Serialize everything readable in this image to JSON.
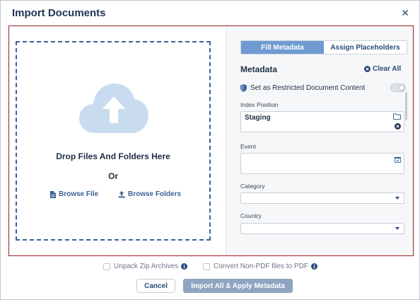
{
  "dialog": {
    "title": "Import Documents",
    "close_icon": "close-icon"
  },
  "dropzone": {
    "icon": "cloud-upload-icon",
    "drop_text": "Drop Files And Folders Here",
    "or_text": "Or",
    "browse_file_label": "Browse File",
    "browse_file_icon": "file-icon",
    "browse_folders_label": "Browse Folders",
    "browse_folders_icon": "upload-icon"
  },
  "tabs": [
    {
      "label": "Fill Metadata",
      "active": true
    },
    {
      "label": "Assign Placeholders",
      "active": false
    }
  ],
  "metadata": {
    "heading": "Metadata",
    "clear_all_label": "Clear All",
    "restricted_label": "Set as Restricted Document Content",
    "restricted_enabled": false,
    "index_position_label": "Index Position",
    "index_position_value": "Staging",
    "event_label": "Event",
    "event_value": "",
    "category_label": "Category",
    "category_value": "",
    "country_label": "Country",
    "country_value": ""
  },
  "footer": {
    "unpack_zip_label": "Unpack Zip Archives",
    "unpack_zip_checked": false,
    "convert_pdf_label": "Convert Non-PDF files to PDF",
    "convert_pdf_checked": false,
    "cancel_label": "Cancel",
    "import_label": "Import All & Apply Metadata"
  },
  "colors": {
    "accent": "#3b6397",
    "tab_active": "#6f9bd1",
    "highlight_border": "#9b1c24",
    "import_button_disabled": "#8fa5c2",
    "cloud": "#c9dcef"
  }
}
